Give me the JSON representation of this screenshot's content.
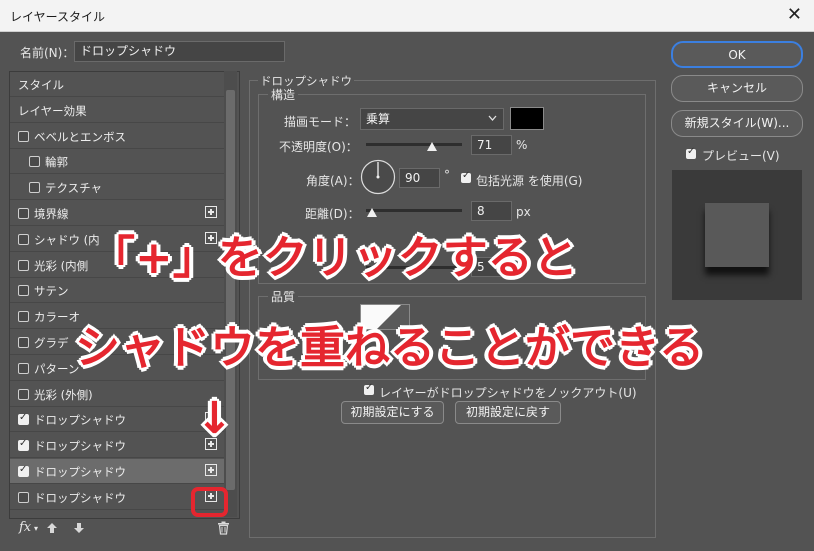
{
  "window": {
    "title": "レイヤースタイル",
    "close": "✕"
  },
  "name_row": {
    "label": "名前(N)：",
    "value": "ドロップシャドウ"
  },
  "styles_list": [
    {
      "label": "スタイル",
      "indent": 0,
      "checkbox": false,
      "checked": false,
      "plus": false
    },
    {
      "label": "レイヤー効果",
      "indent": 0,
      "checkbox": false,
      "checked": false,
      "plus": false
    },
    {
      "label": "ベベルとエンボス",
      "indent": 0,
      "checkbox": true,
      "checked": false,
      "plus": false
    },
    {
      "label": "輪郭",
      "indent": 1,
      "checkbox": true,
      "checked": false,
      "plus": false
    },
    {
      "label": "テクスチャ",
      "indent": 1,
      "checkbox": true,
      "checked": false,
      "plus": false
    },
    {
      "label": "境界線",
      "indent": 0,
      "checkbox": true,
      "checked": false,
      "plus": true
    },
    {
      "label": "シャドウ (内",
      "indent": 0,
      "checkbox": true,
      "checked": false,
      "plus": true
    },
    {
      "label": "光彩 (内側",
      "indent": 0,
      "checkbox": true,
      "checked": false,
      "plus": false
    },
    {
      "label": "サテン",
      "indent": 0,
      "checkbox": true,
      "checked": false,
      "plus": false
    },
    {
      "label": "カラーオ",
      "indent": 0,
      "checkbox": true,
      "checked": false,
      "plus": false
    },
    {
      "label": "グラデ",
      "indent": 0,
      "checkbox": true,
      "checked": false,
      "plus": false
    },
    {
      "label": "パターン",
      "indent": 0,
      "checkbox": true,
      "checked": false,
      "plus": false
    },
    {
      "label": "光彩 (外側)",
      "indent": 0,
      "checkbox": true,
      "checked": false,
      "plus": false
    },
    {
      "label": "ドロップシャドウ",
      "indent": 0,
      "checkbox": true,
      "checked": true,
      "plus": true
    },
    {
      "label": "ドロップシャドウ",
      "indent": 0,
      "checkbox": true,
      "checked": true,
      "plus": true
    },
    {
      "label": "ドロップシャドウ",
      "indent": 0,
      "checkbox": true,
      "checked": true,
      "plus": true,
      "selected": true
    },
    {
      "label": "ドロップシャドウ",
      "indent": 0,
      "checkbox": true,
      "checked": false,
      "plus": true
    }
  ],
  "list_toolbar": {
    "fx": "fx",
    "fx_caret": "▾"
  },
  "drop_shadow": {
    "group_title": "ドロップシャドウ",
    "structure_title": "構造",
    "blend_mode_label": "描画モード：",
    "blend_mode_value": "乗算",
    "blend_color": "#000000",
    "opacity_label": "不透明度(O)：",
    "opacity_value": "71",
    "opacity_unit": "%",
    "angle_label": "角度(A)：",
    "angle_value": "90",
    "angle_unit": "°",
    "global_light_label": "包括光源 を使用(G)",
    "distance_label": "距離(D)：",
    "distance_value": "8",
    "distance_unit": "px",
    "size_value_partial": "5",
    "quality_title": "品質",
    "knockout_label": "レイヤーがドロップシャドウをノックアウト(U)",
    "make_default": "初期設定にする",
    "reset_default": "初期設定に戻す"
  },
  "right_panel": {
    "ok": "OK",
    "cancel": "キャンセル",
    "new_style": "新規スタイル(W)...",
    "preview_label": "プレビュー(V)"
  },
  "overlay": {
    "line1": "「+」をクリックすると",
    "line2": "シャドウを重ねることができる",
    "arrow": "↓",
    "color": "#e5262f"
  }
}
